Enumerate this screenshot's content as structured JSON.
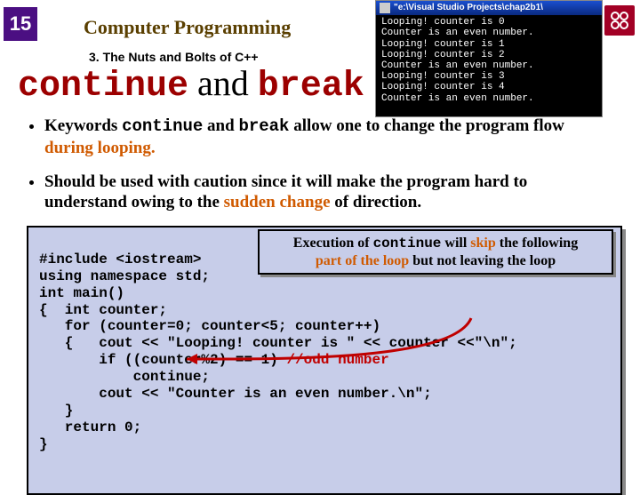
{
  "slide_number": "15",
  "course_title": "Computer Programming",
  "section": "3. The Nuts and Bolts of C++",
  "title_continue": "continue",
  "title_and": " and ",
  "title_break": "break",
  "console": {
    "titlebar": "\"e:\\Visual Studio Projects\\chap2b1\\",
    "lines": [
      "Looping! counter is 0",
      "Counter is an even number.",
      "Looping! counter is 1",
      "Looping! counter is 2",
      "Counter is an even number.",
      "Looping! counter is 3",
      "Looping! counter is 4",
      "Counter is an even number."
    ]
  },
  "bullet1": {
    "pre": "Keywords ",
    "kw1": "continue",
    "mid": " and ",
    "kw2": "break",
    "post": " allow one to change the program flow ",
    "orange": "during looping."
  },
  "bullet2": {
    "pre": "Should be used with caution since it will make the program hard to understand owing to the ",
    "orange": "sudden change",
    "post": " of direction."
  },
  "callout": {
    "l1a": "Execution of ",
    "l1kw": "continue",
    "l1b": " will ",
    "l1skip": "skip",
    "l1c": " the following",
    "l2a": "part of the loop",
    "l2b": " but not leaving the loop"
  },
  "code": {
    "l1": "#include <iostream>",
    "l2": "using namespace std;",
    "l3": "int main()",
    "l4": "{  int counter;",
    "l5": "   for (counter=0; counter<5; counter++)",
    "l6": "   {   cout << \"Looping! counter is \" << counter <<\"\\n\";",
    "l7a": "       if ((counter%2) == 1) ",
    "l7b": "//odd number",
    "l8": "           continue;",
    "l9": "       cout << \"Counter is an even number.\\n\";",
    "l10": "   }",
    "l11": "   return 0;",
    "l12": "}"
  }
}
